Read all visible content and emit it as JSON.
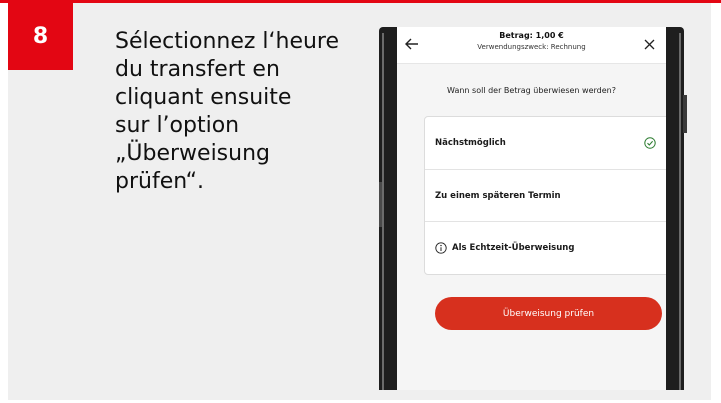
{
  "step": {
    "number": "8"
  },
  "instruction": {
    "lines": [
      "Sélectionnez l‘heure",
      "du transfert en",
      "cliquant ensuite",
      "sur l’option",
      "„Überweisung",
      "prüfen“."
    ]
  },
  "phone": {
    "header": {
      "title": "Betrag: 1,00 €",
      "subtitle": "Verwendungszweck: Rechnung",
      "back_icon": "arrow-left-icon",
      "close_icon": "close-icon"
    },
    "question": "Wann soll der Betrag überwiesen werden?",
    "options": [
      {
        "label": "Nächstmöglich",
        "selected": true,
        "icon": "check-circle-icon"
      },
      {
        "label": "Zu einem späteren Termin",
        "selected": false
      },
      {
        "label": "Als Echtzeit-Überweisung",
        "selected": false,
        "icon": "info-icon"
      }
    ],
    "primary_button": "Überweisung prüfen"
  },
  "colors": {
    "brand_red": "#e30613",
    "button_red": "#d7301e",
    "check_green": "#2e7d32",
    "panel_grey": "#efefef"
  }
}
